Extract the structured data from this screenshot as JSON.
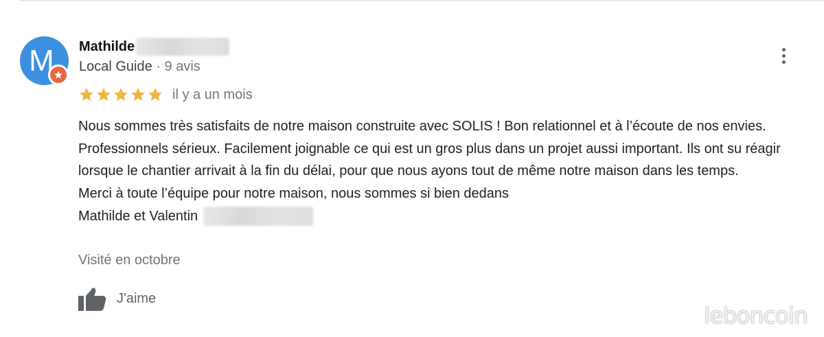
{
  "reviewer": {
    "initial": "M",
    "name": "Mathilde",
    "guide_label": "Local Guide",
    "review_count": "· 9 avis"
  },
  "rating": {
    "stars": 5,
    "max_stars": 5,
    "time": "il y a un mois",
    "star_color": "#f2b53c"
  },
  "review": {
    "paragraph": "Nous sommes très satisfaits de notre maison construite avec SOLIS ! Bon relationnel et à l’écoute de nos envies. Professionnels sérieux. Facilement joignable ce qui est un gros plus dans un projet aussi important. Ils ont su réagir lorsque le chantier arrivait à la fin du délai, pour que nous ayons tout de même notre maison dans les temps.",
    "thanks": "Merci à toute l’équipe pour notre maison, nous sommes si bien dedans",
    "signature": "Mathilde et Valentin"
  },
  "visited": "Visité en octobre",
  "actions": {
    "like_label": "J'aime"
  },
  "icons": {
    "menu": "more-vertical-icon",
    "like": "thumbs-up-icon",
    "badge": "local-guide-badge-icon",
    "star": "star-icon"
  },
  "colors": {
    "avatar_bg": "#3d8fe0",
    "badge_bg": "#e8663d",
    "muted_text": "#70757a"
  },
  "watermark": "leboncoin"
}
